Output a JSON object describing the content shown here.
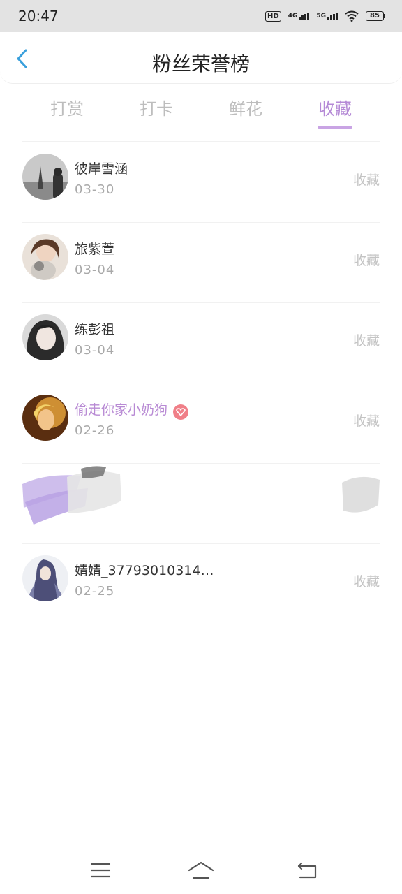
{
  "status_bar": {
    "time": "20:47",
    "battery": "85",
    "hd": "HD",
    "sim1": "4G",
    "sim2": "5G"
  },
  "header": {
    "title": "粉丝荣誉榜"
  },
  "tabs": [
    {
      "label": "打赏",
      "active": false
    },
    {
      "label": "打卡",
      "active": false
    },
    {
      "label": "鲜花",
      "active": false
    },
    {
      "label": "收藏",
      "active": true
    }
  ],
  "fans": [
    {
      "name": "彼岸雪涵",
      "date": "03-30",
      "action": "收藏"
    },
    {
      "name": "旅紫萱",
      "date": "03-04",
      "action": "收藏"
    },
    {
      "name": "练彭祖",
      "date": "03-04",
      "action": "收藏"
    },
    {
      "name": "偷走你家小奶狗",
      "date": "02-26",
      "action": "收藏",
      "vip": true
    },
    {
      "name": "",
      "date": "",
      "action": "",
      "redacted": true
    },
    {
      "name": "婧婧_37793010314…",
      "date": "02-25",
      "action": "收藏"
    }
  ],
  "colors": {
    "accent": "#b58ad6",
    "underline": "#c9a4e4",
    "badge": "#f07f88",
    "back_arrow": "#3aa0dc"
  },
  "icons": {
    "back": "chevron-left-icon",
    "menu": "menu-icon",
    "home": "home-icon",
    "return": "return-icon",
    "badge": "heart-gem-icon"
  }
}
